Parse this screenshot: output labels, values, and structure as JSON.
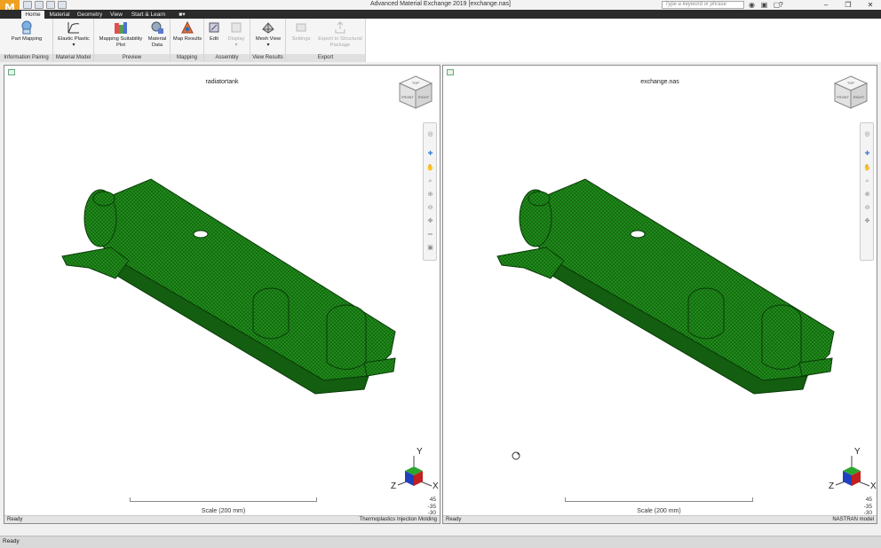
{
  "app": {
    "logo_letter": "M",
    "window_title": "Advanced Material Exchange 2019    [exchange.nas]",
    "search_placeholder": "Type a keyword or phrase"
  },
  "tabs": [
    "Home",
    "Material",
    "Geometry",
    "View",
    "Start & Learn"
  ],
  "ribbon": {
    "groups": {
      "info_pairing": "Information Pairing",
      "material_model": "Material Model",
      "preview": "Preview",
      "mapping": "Mapping",
      "assembly": "Assembly",
      "view_results": "View Results",
      "export": "Export"
    },
    "buttons": {
      "part_mapping": "Part Mapping",
      "elastic_plastic": "Elastic Plastic",
      "mapping_suitability_1": "Mapping Suitability",
      "mapping_suitability_2": "Plot",
      "material_data_1": "Material",
      "material_data_2": "Data",
      "map_results": "Map Results",
      "edit": "Edit",
      "display": "Display",
      "mesh_view": "Mesh View",
      "settings": "Settings",
      "export_structural_1": "Export to Structural",
      "export_structural_2": "Package"
    }
  },
  "viewports": {
    "left": {
      "title": "radiatortank",
      "scale": "Scale (200 mm)",
      "angles": [
        "45",
        "-35",
        "-30"
      ],
      "status_left": "Ready",
      "status_right": "Thermoplastics Injection Molding"
    },
    "right": {
      "title": "exchange.nas",
      "scale": "Scale (200 mm)",
      "angles": [
        "45",
        "-35",
        "-30"
      ],
      "status_left": "Ready",
      "status_right": "NASTRAN model"
    },
    "axes": {
      "x": "X",
      "y": "Y",
      "z": "Z"
    },
    "viewcube": {
      "top": "TOP",
      "front": "FRONT",
      "right": "RIGHT"
    }
  },
  "statusbar": {
    "text": "Ready"
  },
  "colors": {
    "mesh_green": "#1f8a1a",
    "mesh_dark": "#0d4f0b",
    "tab_bar": "#2b2b2b",
    "logo": "#f0a020"
  }
}
